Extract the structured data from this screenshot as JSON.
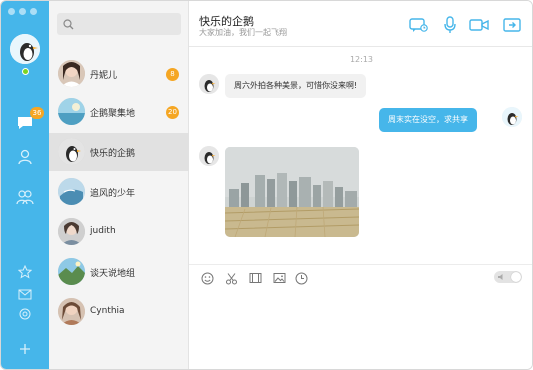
{
  "colors": {
    "accent": "#46b6ea",
    "badge": "#f5a623",
    "online": "#7ed321"
  },
  "rail": {
    "chat_badge": "36",
    "icons": [
      "chat-icon",
      "contacts-icon",
      "groups-icon",
      "star-icon",
      "mail-icon",
      "settings-icon",
      "add-icon"
    ]
  },
  "search": {
    "placeholder": "",
    "value": ""
  },
  "conversations": [
    {
      "name": "丹妮儿",
      "badge": "8"
    },
    {
      "name": "企鹅聚集地",
      "badge": "20"
    },
    {
      "name": "快乐的企鹅",
      "badge": ""
    },
    {
      "name": "追风的少年",
      "badge": ""
    },
    {
      "name": "judith",
      "badge": ""
    },
    {
      "name": "谈天说地组",
      "badge": ""
    },
    {
      "name": "Cynthia",
      "badge": ""
    }
  ],
  "chat": {
    "title": "快乐的企鹅",
    "subtitle": "大家加油，我们一起飞翔",
    "time": "12:13",
    "messages": [
      {
        "side": "in",
        "text": "周六外拍各种美景，可惜你没来啊!"
      },
      {
        "side": "out",
        "text": "周末实在没空，求共享"
      }
    ]
  },
  "header_icons": [
    "video-chat-icon",
    "microphone-icon",
    "camera-icon",
    "share-icon"
  ],
  "toolbar_icons": [
    "emoji-icon",
    "scissors-icon",
    "film-icon",
    "image-icon",
    "clock-icon"
  ]
}
